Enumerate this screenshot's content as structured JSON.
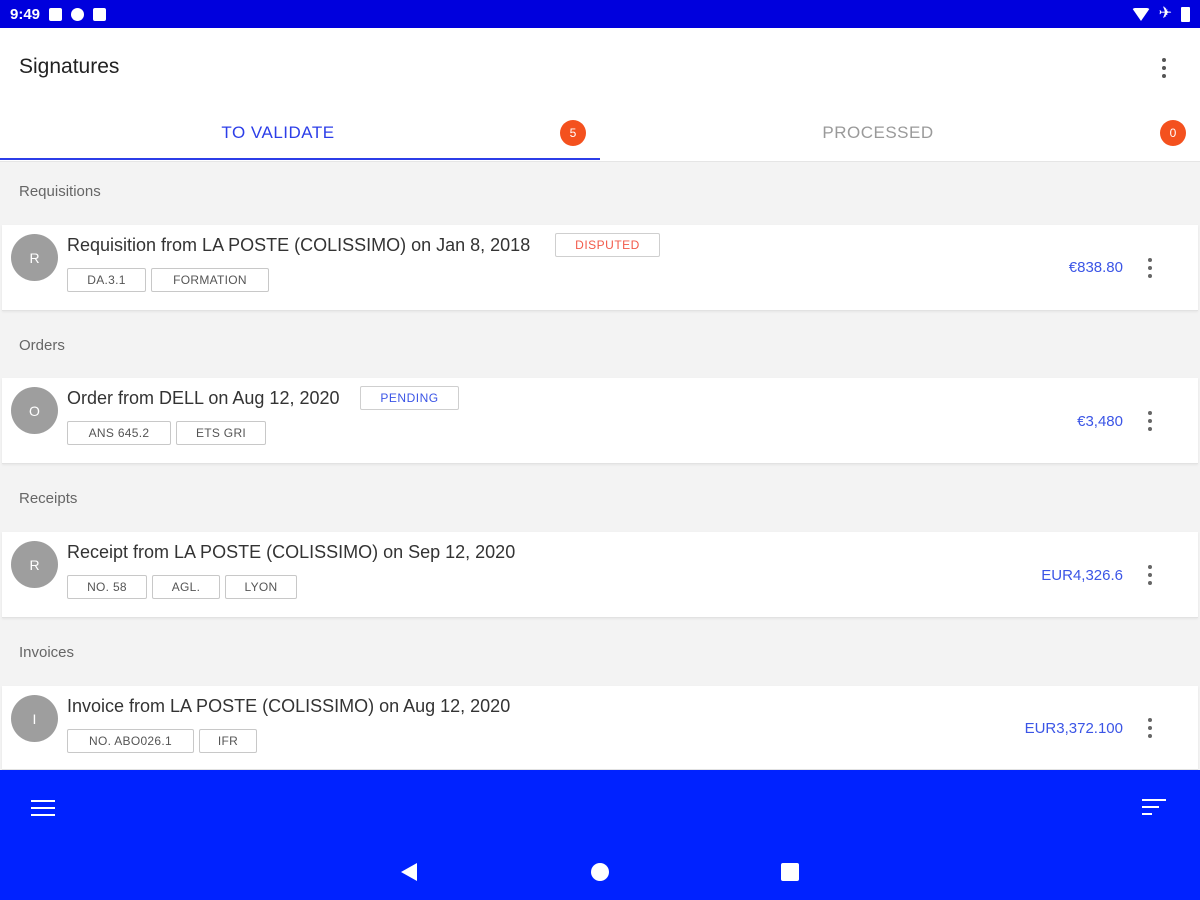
{
  "status_bar": {
    "time": "9:49",
    "wifi_icon": "wifi-icon",
    "plane_icon": "airplane-icon",
    "battery_icon": "battery-icon"
  },
  "app": {
    "title": "Signatures",
    "overflow_icon": "more-vert-icon"
  },
  "tabs": [
    {
      "label": "TO VALIDATE",
      "badge": "5",
      "active": true
    },
    {
      "label": "PROCESSED",
      "badge": "0",
      "active": false
    }
  ],
  "colors": {
    "accent": "#2c3ee8",
    "badge": "#f4511e",
    "status_bar": "#0000dd",
    "bottom_bar": "#0022ff",
    "disputed": "#f25a4a",
    "pending": "#3b55e6"
  },
  "sections": [
    {
      "header": "Requisitions",
      "item": {
        "avatar": "R",
        "title": "Requisition from LA POSTE (COLISSIMO) on Jan 8, 2018",
        "status": "DISPUTED",
        "tags": [
          "DA.3.1",
          "FORMATION"
        ],
        "amount": "€838.80"
      }
    },
    {
      "header": "Orders",
      "item": {
        "avatar": "O",
        "title": "Order from DELL on Aug 12, 2020",
        "status": "PENDING",
        "tags": [
          "ANS 645.2",
          "ETS GRI"
        ],
        "amount": "€3,480"
      }
    },
    {
      "header": "Receipts",
      "item": {
        "avatar": "R",
        "title": "Receipt from LA POSTE (COLISSIMO) on Sep 12, 2020",
        "status": "",
        "tags": [
          "NO. 58",
          "AGL.",
          "LYON"
        ],
        "amount": "EUR4,326.6"
      }
    },
    {
      "header": "Invoices",
      "item": {
        "avatar": "I",
        "title": "Invoice from LA POSTE (COLISSIMO) on Aug 12, 2020",
        "status": "",
        "tags": [
          "NO. ABO026.1",
          "IFR"
        ],
        "amount": "EUR3,372.100"
      }
    }
  ],
  "bottom_bar": {
    "menu_icon": "menu-icon",
    "sort_icon": "sort-icon"
  },
  "nav_bar": {
    "back_icon": "back-icon",
    "home_icon": "home-icon",
    "recents_icon": "recents-icon"
  }
}
